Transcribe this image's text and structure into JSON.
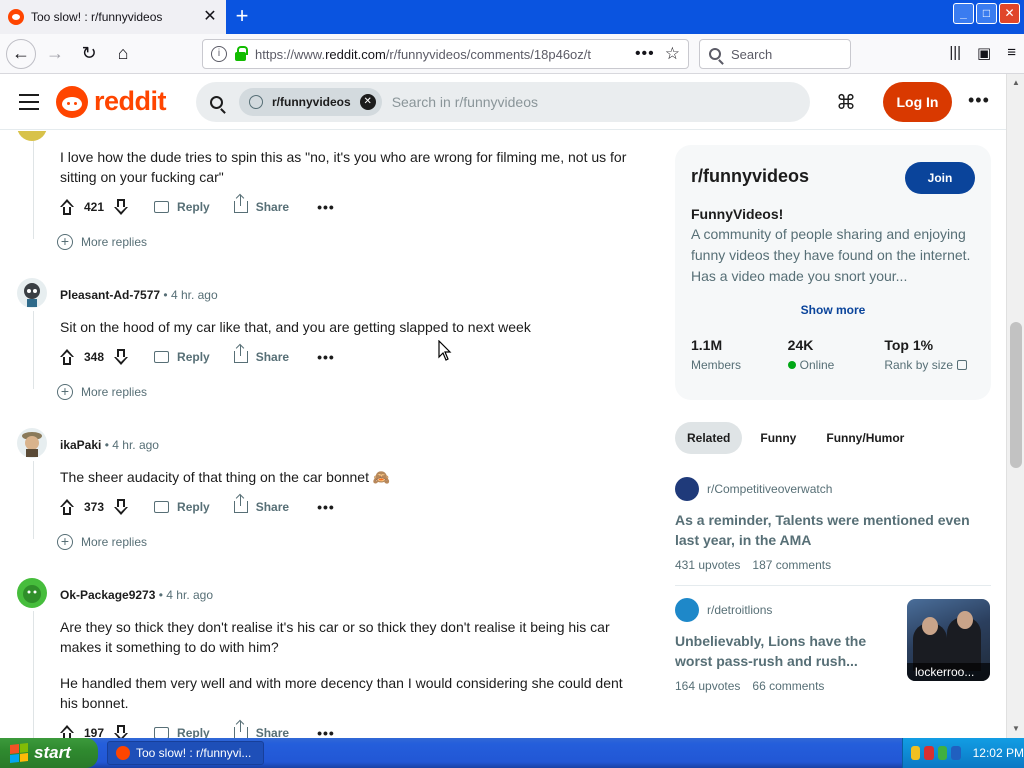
{
  "browser": {
    "tab_title": "Too slow! : r/funnyvideos",
    "url_prefix": "https://www.",
    "url_domain": "reddit.com",
    "url_rest": "/r/funnyvideos/comments/18p46oz/t",
    "search_placeholder": "Search",
    "new_tab": "+",
    "close_tab": "✕",
    "page_actions": "•••",
    "bookmark_star": "☆"
  },
  "reddit": {
    "wordmark": "reddit",
    "search_chip": "r/funnyvideos",
    "search_placeholder": "Search in r/funnyvideos",
    "login": "Log In",
    "more": "•••"
  },
  "comments": [
    {
      "author": "",
      "time": "",
      "text": "I love how the dude tries to spin this as \"no, it's you who are wrong for filming me, not us for sitting on your fucking car\"",
      "score": "421",
      "more_replies": "More replies"
    },
    {
      "author": "Pleasant-Ad-7577",
      "time": "4 hr. ago",
      "text": "Sit on the hood of my car like that, and you are getting slapped to next week",
      "score": "348",
      "more_replies": "More replies"
    },
    {
      "author": "ikaPaki",
      "time": "4 hr. ago",
      "text": "The sheer audacity of that thing on the car bonnet 🙈",
      "score": "373",
      "more_replies": "More replies"
    },
    {
      "author": "Ok-Package9273",
      "time": "4 hr. ago",
      "text": "Are they so thick they don't realise it's his car or so thick they don't realise it being his car makes it something to do with him?",
      "text2": "He handled them very well and with more decency than I would considering she could dent his bonnet.",
      "score": "197"
    }
  ],
  "actions": {
    "reply": "Reply",
    "share": "Share",
    "overflow": "•••",
    "separator": "•"
  },
  "sidebar": {
    "name": "r/funnyvideos",
    "join": "Join",
    "title": "FunnyVideos!",
    "description": "A community of people sharing and enjoying funny videos they have found on the internet. Has a video made you snort your...",
    "show_more": "Show more",
    "stats": [
      {
        "value": "1.1M",
        "label": "Members"
      },
      {
        "value": "24K",
        "label": "Online"
      },
      {
        "value": "Top 1%",
        "label": "Rank by size"
      }
    ]
  },
  "related_tabs": [
    "Related",
    "Funny",
    "Funny/Humor"
  ],
  "related_posts": [
    {
      "subreddit": "r/Competitiveoverwatch",
      "title": "As a reminder, Talents were mentioned even last year, in the AMA",
      "upvotes": "431 upvotes",
      "comments": "187 comments"
    },
    {
      "subreddit": "r/detroitlions",
      "title": "Unbelievably, Lions have the worst pass-rush and rush...",
      "upvotes": "164 upvotes",
      "comments": "66 comments",
      "thumb_caption": "lockerroo..."
    }
  ],
  "taskbar": {
    "start": "start",
    "task": "Too slow! : r/funnyvi...",
    "clock": "12:02 PM"
  },
  "colors": {
    "accent": "#ff4500",
    "login": "#d93900",
    "join": "#0a449b",
    "online_dot": "#01a816"
  }
}
